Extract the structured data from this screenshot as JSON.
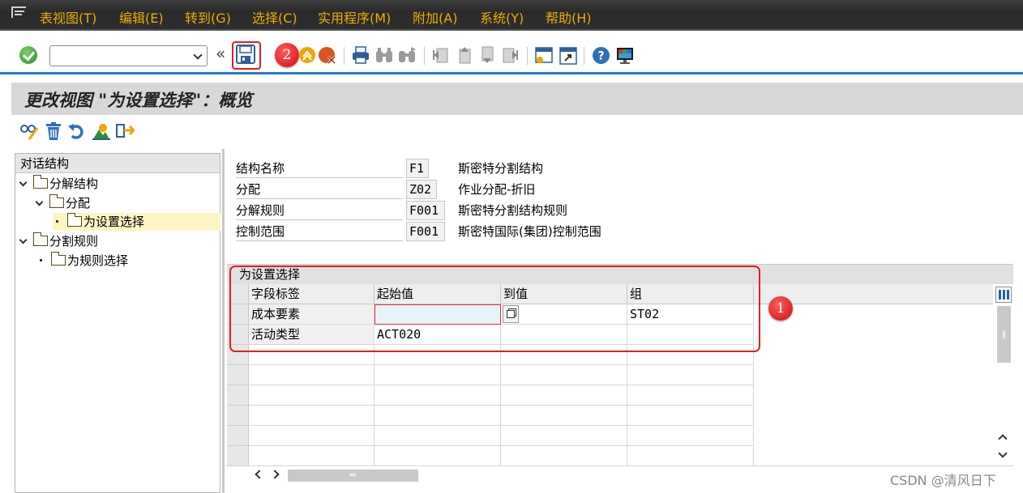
{
  "menu": [
    "表视图(T)",
    "编辑(E)",
    "转到(G)",
    "选择(C)",
    "实用程序(M)",
    "附加(A)",
    "系统(Y)",
    "帮助(H)"
  ],
  "toolbar": {
    "command_value": "",
    "double_left": "«"
  },
  "annotations": {
    "badge_save": "2",
    "badge_table": "1"
  },
  "page_title": "更改视图 \"为设置选择\"：概览",
  "tree": {
    "header": "对话结构",
    "nodes": [
      "分解结构",
      "分配",
      "为设置选择",
      "分割规则",
      "为规则选择"
    ]
  },
  "header_fields": [
    {
      "label": "结构名称",
      "value": "F1",
      "desc": "斯密特分割结构"
    },
    {
      "label": "分配",
      "value": "Z02",
      "desc": "作业分配-折旧"
    },
    {
      "label": "分解规则",
      "value": "F001",
      "desc": "斯密特分割结构规则"
    },
    {
      "label": "控制范围",
      "value": "F001",
      "desc": "斯密特国际(集团)控制范围"
    }
  ],
  "table": {
    "title": "为设置选择",
    "columns": [
      "字段标签",
      "起始值",
      "到值",
      "组"
    ],
    "rows": [
      [
        "成本要素",
        "",
        "",
        "ST02"
      ],
      [
        "活动类型",
        "ACT020",
        "",
        ""
      ]
    ]
  },
  "watermark": "CSDN @清风日下",
  "colors": {
    "menu_text": "#f0ab00",
    "accent_blue": "#1f7fd1",
    "highlight_red": "#e02020",
    "tree_selected": "#fdf6c3"
  }
}
